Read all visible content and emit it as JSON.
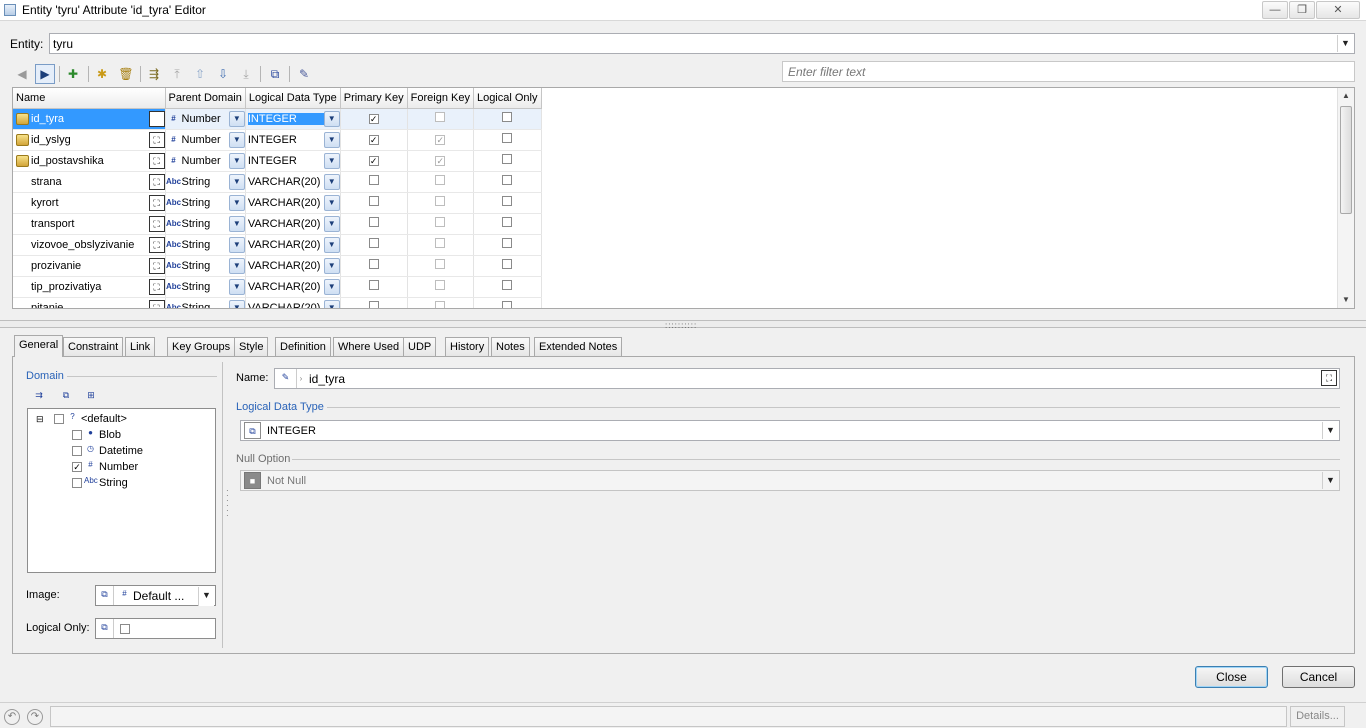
{
  "window": {
    "title": "Entity 'tyru' Attribute 'id_tyra' Editor",
    "controls": {
      "minimize": "—",
      "maximize": "❐",
      "close": "✕"
    }
  },
  "entity": {
    "label": "Entity:",
    "value": "tyru"
  },
  "filter": {
    "placeholder": "Enter filter text"
  },
  "grid": {
    "columns": [
      "Name",
      "Parent Domain",
      "Logical Data Type",
      "Primary Key",
      "Foreign Key",
      "Logical Only"
    ],
    "rows": [
      {
        "name": "id_tyra",
        "domain": "Number",
        "type": "INTEGER",
        "pk": true,
        "fk": false,
        "lo": false,
        "key": true,
        "selected": true
      },
      {
        "name": "id_yslyg",
        "domain": "Number",
        "type": "INTEGER",
        "pk": true,
        "fk": true,
        "lo": false,
        "key": true,
        "selected": false
      },
      {
        "name": "id_postavshika",
        "domain": "Number",
        "type": "INTEGER",
        "pk": true,
        "fk": true,
        "lo": false,
        "key": true,
        "selected": false
      },
      {
        "name": "strana",
        "domain": "String",
        "type": "VARCHAR(20)",
        "pk": false,
        "fk": false,
        "lo": false,
        "key": false,
        "selected": false
      },
      {
        "name": "kyrort",
        "domain": "String",
        "type": "VARCHAR(20)",
        "pk": false,
        "fk": false,
        "lo": false,
        "key": false,
        "selected": false
      },
      {
        "name": "transport",
        "domain": "String",
        "type": "VARCHAR(20)",
        "pk": false,
        "fk": false,
        "lo": false,
        "key": false,
        "selected": false
      },
      {
        "name": "vizovoe_obslyzivanie",
        "domain": "String",
        "type": "VARCHAR(20)",
        "pk": false,
        "fk": false,
        "lo": false,
        "key": false,
        "selected": false
      },
      {
        "name": "prozivanie",
        "domain": "String",
        "type": "VARCHAR(20)",
        "pk": false,
        "fk": false,
        "lo": false,
        "key": false,
        "selected": false
      },
      {
        "name": "tip_prozivatiya",
        "domain": "String",
        "type": "VARCHAR(20)",
        "pk": false,
        "fk": false,
        "lo": false,
        "key": false,
        "selected": false
      },
      {
        "name": "pitanie",
        "domain": "String",
        "type": "VARCHAR(20)",
        "pk": false,
        "fk": false,
        "lo": false,
        "key": false,
        "selected": false
      }
    ]
  },
  "tabs": [
    "General",
    "Constraint",
    "Link",
    "Key Groups",
    "Style",
    "Definition",
    "Where Used",
    "UDP",
    "History",
    "Notes",
    "Extended Notes"
  ],
  "domain_panel": {
    "label": "Domain",
    "tree": [
      {
        "label": "<default>",
        "checked": false
      },
      {
        "label": "Blob",
        "checked": false
      },
      {
        "label": "Datetime",
        "checked": false
      },
      {
        "label": "Number",
        "checked": true
      },
      {
        "label": "String",
        "checked": false
      }
    ],
    "image_label": "Image:",
    "image_value": "Default ...",
    "logical_only_label": "Logical Only:"
  },
  "detail": {
    "name_label": "Name:",
    "name_value": "id_tyra",
    "ldt_label": "Logical Data Type",
    "ldt_value": "INTEGER",
    "null_label": "Null Option",
    "null_value": "Not Null"
  },
  "buttons": {
    "close": "Close",
    "cancel": "Cancel",
    "details": "Details..."
  }
}
